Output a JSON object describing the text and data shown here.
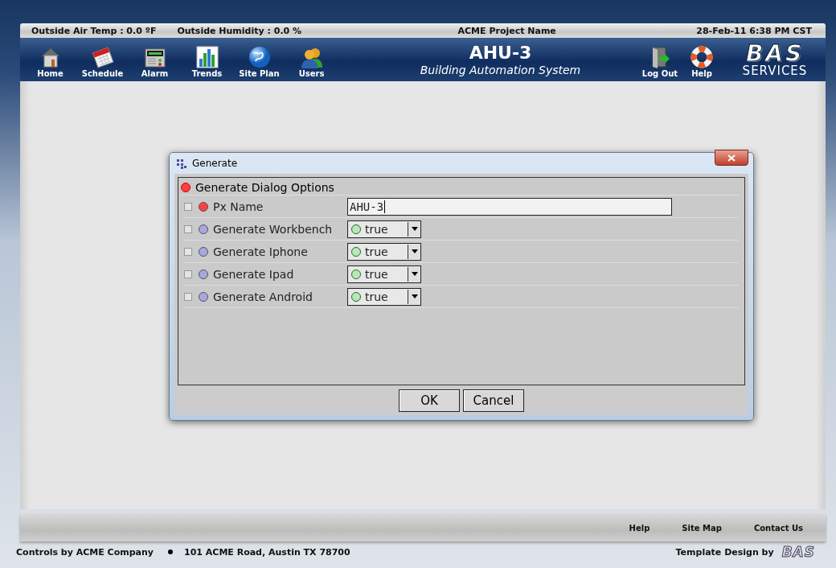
{
  "status_bar": {
    "outside_air_temp": "Outside Air Temp : 0.0 ºF",
    "outside_humidity": "Outside Humidity : 0.0 %",
    "project_name": "ACME Project Name",
    "datetime": "28-Feb-11 6:38 PM CST"
  },
  "nav": [
    {
      "label": "Home"
    },
    {
      "label": "Schedule"
    },
    {
      "label": "Alarm"
    },
    {
      "label": "Trends"
    },
    {
      "label": "Site Plan"
    },
    {
      "label": "Users"
    }
  ],
  "header": {
    "title": "AHU-3",
    "subtitle": "Building Automation System"
  },
  "right_nav": [
    {
      "label": "Log Out"
    },
    {
      "label": "Help"
    }
  ],
  "logo": {
    "text": "BAS",
    "subtext": "SERVICES"
  },
  "dialog": {
    "title": "Generate",
    "group": {
      "label": "Generate Dialog Options",
      "color": "#ff4040"
    },
    "rows": [
      {
        "kind": "text",
        "checked": false,
        "label": "Px Name",
        "color": "#ff4040",
        "value": "AHU-3"
      },
      {
        "kind": "dropdown",
        "checked": false,
        "label": "Generate Workbench",
        "color": "#a8a8e0",
        "value": {
          "text": "true",
          "color": "#b8e8b8"
        }
      },
      {
        "kind": "dropdown",
        "checked": false,
        "label": "Generate Iphone",
        "color": "#a8a8e0",
        "value": {
          "text": "true",
          "color": "#b8e8b8"
        }
      },
      {
        "kind": "dropdown",
        "checked": false,
        "label": "Generate Ipad",
        "color": "#a8a8e0",
        "value": {
          "text": "true",
          "color": "#b8e8b8"
        }
      },
      {
        "kind": "dropdown",
        "checked": false,
        "label": "Generate Android",
        "color": "#a8a8e0",
        "value": {
          "text": "true",
          "color": "#b8e8b8"
        }
      }
    ],
    "buttons": [
      "OK",
      "Cancel"
    ]
  },
  "footer": {
    "links": [
      "Help",
      "Site Map",
      "Contact Us"
    ],
    "company": "Controls by ACME Company",
    "address": "101 ACME Road, Austin TX 78700",
    "credit": "Template Design by",
    "credit_logo": "BAS"
  }
}
